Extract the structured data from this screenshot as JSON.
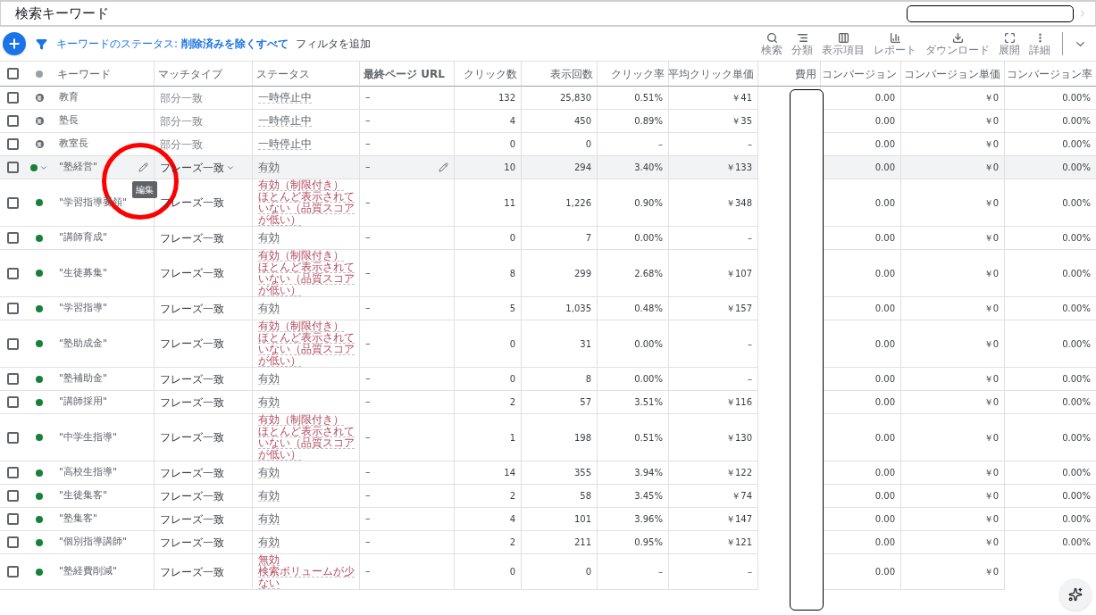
{
  "page_title": "検索キーワード",
  "toolbar": {
    "filter_label": "キーワードのステータス:",
    "filter_value": "削除済みを除くすべて",
    "add_filter": "フィルタを追加",
    "tools": [
      {
        "kind": "search",
        "label": "検索"
      },
      {
        "kind": "segment",
        "label": "分類"
      },
      {
        "kind": "columns",
        "label": "表示項目"
      },
      {
        "kind": "report",
        "label": "レポート"
      },
      {
        "kind": "download",
        "label": "ダウンロード"
      },
      {
        "kind": "expand",
        "label": "展開"
      },
      {
        "kind": "more",
        "label": "詳細"
      }
    ]
  },
  "table": {
    "header_checked": false,
    "columns": [
      "キーワード",
      "マッチタイプ",
      "ステータス",
      "最終ページ URL",
      "クリック数",
      "表示回数",
      "クリック率",
      "平均クリック単価",
      "費用",
      "コンバージョン",
      "コンバージョン単価",
      "コンバージョン率"
    ],
    "rows": [
      {
        "checked": false,
        "paused": true,
        "highlighted": false,
        "keyword": "教育",
        "match": "部分一致",
        "limited": false,
        "status": [
          "一時停止中"
        ],
        "url": "–",
        "clicks": "132",
        "impr": "25,830",
        "ctr": "0.51%",
        "cpc": "￥41",
        "conv": "0.00",
        "cpa": "￥0",
        "rate": "0.00%"
      },
      {
        "checked": false,
        "paused": true,
        "highlighted": false,
        "keyword": "塾長",
        "match": "部分一致",
        "limited": false,
        "status": [
          "一時停止中"
        ],
        "url": "–",
        "clicks": "4",
        "impr": "450",
        "ctr": "0.89%",
        "cpc": "￥35",
        "conv": "0.00",
        "cpa": "￥0",
        "rate": "0.00%"
      },
      {
        "checked": false,
        "paused": true,
        "highlighted": false,
        "keyword": "教室長",
        "match": "部分一致",
        "limited": false,
        "status": [
          "一時停止中"
        ],
        "url": "–",
        "clicks": "0",
        "impr": "0",
        "ctr": "–",
        "cpc": "–",
        "conv": "0.00",
        "cpa": "￥0",
        "rate": "0.00%"
      },
      {
        "checked": false,
        "paused": false,
        "highlighted": true,
        "keyword": "\"塾経営\"",
        "match": "フレーズ一致",
        "limited": false,
        "status": [
          "有効"
        ],
        "url": "–",
        "clicks": "10",
        "impr": "294",
        "ctr": "3.40%",
        "cpc": "￥133",
        "conv": "0.00",
        "cpa": "￥0",
        "rate": "0.00%"
      },
      {
        "checked": false,
        "paused": false,
        "highlighted": false,
        "keyword": "\"学習指導要領\"",
        "match": "フレーズ一致",
        "limited": true,
        "status": [
          "有効（制限付き）",
          "ほとんど表示されて",
          "いない（品質スコア",
          "が低い）"
        ],
        "url": "–",
        "clicks": "11",
        "impr": "1,226",
        "ctr": "0.90%",
        "cpc": "￥348",
        "conv": "0.00",
        "cpa": "￥0",
        "rate": "0.00%"
      },
      {
        "checked": false,
        "paused": false,
        "highlighted": false,
        "keyword": "\"講師育成\"",
        "match": "フレーズ一致",
        "limited": false,
        "status": [
          "有効"
        ],
        "url": "–",
        "clicks": "0",
        "impr": "7",
        "ctr": "0.00%",
        "cpc": "–",
        "conv": "0.00",
        "cpa": "￥0",
        "rate": "0.00%"
      },
      {
        "checked": false,
        "paused": false,
        "highlighted": false,
        "keyword": "\"生徒募集\"",
        "match": "フレーズ一致",
        "limited": true,
        "status": [
          "有効（制限付き）",
          "ほとんど表示されて",
          "いない（品質スコア",
          "が低い）"
        ],
        "url": "–",
        "clicks": "8",
        "impr": "299",
        "ctr": "2.68%",
        "cpc": "￥107",
        "conv": "0.00",
        "cpa": "￥0",
        "rate": "0.00%"
      },
      {
        "checked": false,
        "paused": false,
        "highlighted": false,
        "keyword": "\"学習指導\"",
        "match": "フレーズ一致",
        "limited": false,
        "status": [
          "有効"
        ],
        "url": "–",
        "clicks": "5",
        "impr": "1,035",
        "ctr": "0.48%",
        "cpc": "￥157",
        "conv": "0.00",
        "cpa": "￥0",
        "rate": "0.00%"
      },
      {
        "checked": false,
        "paused": false,
        "highlighted": false,
        "keyword": "\"塾助成金\"",
        "match": "フレーズ一致",
        "limited": true,
        "status": [
          "有効（制限付き）",
          "ほとんど表示されて",
          "いない（品質スコア",
          "が低い）"
        ],
        "url": "–",
        "clicks": "0",
        "impr": "31",
        "ctr": "0.00%",
        "cpc": "–",
        "conv": "0.00",
        "cpa": "￥0",
        "rate": "0.00%"
      },
      {
        "checked": false,
        "paused": false,
        "highlighted": false,
        "keyword": "\"塾補助金\"",
        "match": "フレーズ一致",
        "limited": false,
        "status": [
          "有効"
        ],
        "url": "–",
        "clicks": "0",
        "impr": "8",
        "ctr": "0.00%",
        "cpc": "–",
        "conv": "0.00",
        "cpa": "￥0",
        "rate": "0.00%"
      },
      {
        "checked": false,
        "paused": false,
        "highlighted": false,
        "keyword": "\"講師採用\"",
        "match": "フレーズ一致",
        "limited": false,
        "status": [
          "有効"
        ],
        "url": "–",
        "clicks": "2",
        "impr": "57",
        "ctr": "3.51%",
        "cpc": "￥116",
        "conv": "0.00",
        "cpa": "￥0",
        "rate": "0.00%"
      },
      {
        "checked": false,
        "paused": false,
        "highlighted": false,
        "keyword": "\"中学生指導\"",
        "match": "フレーズ一致",
        "limited": true,
        "status": [
          "有効（制限付き）",
          "ほとんど表示されて",
          "いない（品質スコア",
          "が低い）"
        ],
        "url": "–",
        "clicks": "1",
        "impr": "198",
        "ctr": "0.51%",
        "cpc": "￥130",
        "conv": "0.00",
        "cpa": "￥0",
        "rate": "0.00%"
      },
      {
        "checked": false,
        "paused": false,
        "highlighted": false,
        "keyword": "\"高校生指導\"",
        "match": "フレーズ一致",
        "limited": false,
        "status": [
          "有効"
        ],
        "url": "–",
        "clicks": "14",
        "impr": "355",
        "ctr": "3.94%",
        "cpc": "￥122",
        "conv": "0.00",
        "cpa": "￥0",
        "rate": "0.00%"
      },
      {
        "checked": false,
        "paused": false,
        "highlighted": false,
        "keyword": "\"生徒集客\"",
        "match": "フレーズ一致",
        "limited": false,
        "status": [
          "有効"
        ],
        "url": "–",
        "clicks": "2",
        "impr": "58",
        "ctr": "3.45%",
        "cpc": "￥74",
        "conv": "0.00",
        "cpa": "￥0",
        "rate": "0.00%"
      },
      {
        "checked": false,
        "paused": false,
        "highlighted": false,
        "keyword": "\"塾集客\"",
        "match": "フレーズ一致",
        "limited": false,
        "status": [
          "有効"
        ],
        "url": "–",
        "clicks": "4",
        "impr": "101",
        "ctr": "3.96%",
        "cpc": "￥147",
        "conv": "0.00",
        "cpa": "￥0",
        "rate": "0.00%"
      },
      {
        "checked": false,
        "paused": false,
        "highlighted": false,
        "keyword": "\"個別指導講師\"",
        "match": "フレーズ一致",
        "limited": false,
        "status": [
          "有効"
        ],
        "url": "–",
        "clicks": "2",
        "impr": "211",
        "ctr": "0.95%",
        "cpc": "￥121",
        "conv": "0.00",
        "cpa": "￥0",
        "rate": "0.00%"
      },
      {
        "checked": false,
        "paused": false,
        "highlighted": false,
        "keyword": "\"塾経費削減\"",
        "match": "フレーズ一致",
        "limited": true,
        "status": [
          "無効",
          "検索ボリュームが少",
          "ない"
        ],
        "url": "–",
        "clicks": "0",
        "impr": "0",
        "ctr": "–",
        "cpc": "–",
        "conv": "0.00",
        "cpa": "￥0"
      }
    ]
  },
  "tooltip": "編集"
}
